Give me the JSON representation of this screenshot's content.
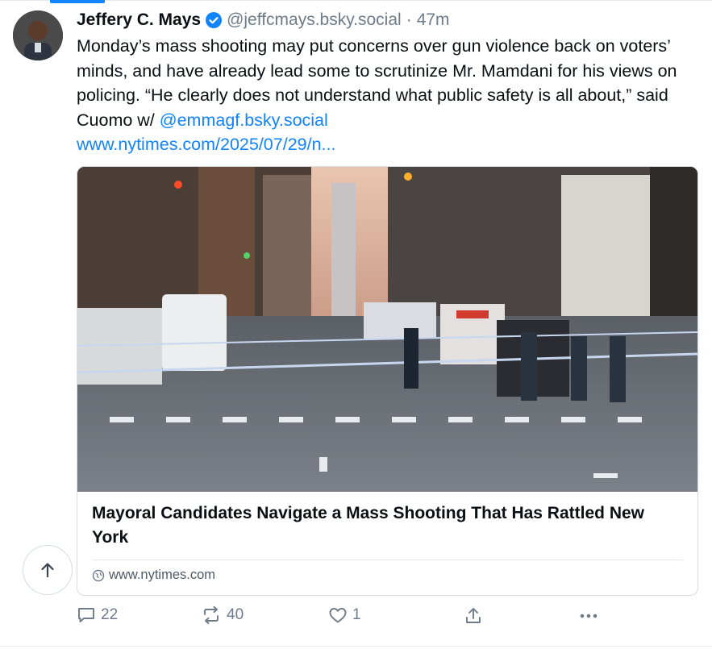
{
  "post": {
    "author_name": "Jeffery C. Mays",
    "handle": "@jeffcmays.bsky.social",
    "separator": "·",
    "time": "47m",
    "text_main": "Monday’s mass shooting may put concerns over gun violence back on voters’ minds, and have already lead some to scrutinize Mr. Mamdani for his views on policing. “He clearly does not understand what public safety is all about,” said Cuomo w/ ",
    "mention": "@emmagf.bsky.social",
    "link_text": "www.nytimes.com/2025/07/29/n..."
  },
  "embed": {
    "title": "Mayoral Candidates Navigate a Mass Shooting That Has Rattled New York",
    "domain": "www.nytimes.com"
  },
  "actions": {
    "reply_count": "22",
    "repost_count": "40",
    "like_count": "1"
  },
  "icons": {
    "verified": "verified-check-icon",
    "globe": "globe-icon",
    "scroll_top": "arrow-up-icon",
    "reply": "speech-bubble-icon",
    "repost": "repost-arrows-icon",
    "like": "heart-icon",
    "share": "share-upload-icon",
    "more": "ellipsis-icon"
  },
  "colors": {
    "accent": "#1083fe",
    "muted_text": "#6e7b8a",
    "border": "#d4dbe2"
  }
}
